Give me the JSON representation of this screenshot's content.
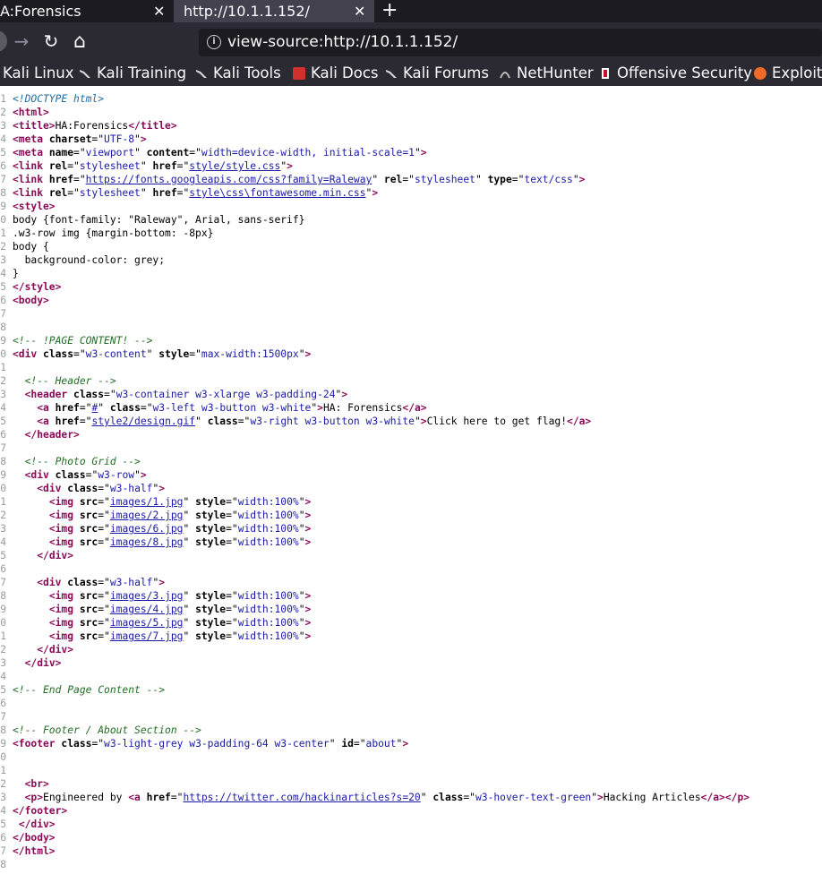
{
  "browser": {
    "tabs": [
      {
        "label": "A:Forensics",
        "close": "✕"
      },
      {
        "label": "http://10.1.1.152/",
        "close": "✕"
      }
    ],
    "new_tab": "+",
    "nav": {
      "back": "←",
      "forward": "→",
      "reload": "↻",
      "home": "⌂"
    },
    "url": "view-source:http://10.1.1.152/",
    "bookmarks": [
      {
        "label": "Kali Linux",
        "icon": "kali-dragon-icon"
      },
      {
        "label": "Kali Training",
        "icon": "kali-dragon-icon"
      },
      {
        "label": "Kali Tools",
        "icon": "kali-dragon-icon"
      },
      {
        "label": "Kali Docs",
        "icon": "kali-docs-icon"
      },
      {
        "label": "Kali Forums",
        "icon": "kali-dragon-icon"
      },
      {
        "label": "NetHunter",
        "icon": "nethunter-icon"
      },
      {
        "label": "Offensive Security",
        "icon": "offsec-icon"
      },
      {
        "label": "Exploit-",
        "icon": "exploit-db-icon"
      }
    ]
  },
  "source_lines": [
    [
      [
        "dt",
        "<!DOCTYPE html>"
      ]
    ],
    [
      [
        "tg",
        "<html>"
      ]
    ],
    [
      [
        "tg",
        "<title>"
      ],
      [
        "tx",
        "HA:Forensics"
      ],
      [
        "tg",
        "</title>"
      ]
    ],
    [
      [
        "tg",
        "<meta "
      ],
      [
        "an",
        "charset"
      ],
      [
        "tx",
        "=\""
      ],
      [
        "av",
        "UTF-8"
      ],
      [
        "tx",
        "\""
      ],
      [
        "tg",
        ">"
      ]
    ],
    [
      [
        "tg",
        "<meta "
      ],
      [
        "an",
        "name"
      ],
      [
        "tx",
        "=\""
      ],
      [
        "av",
        "viewport"
      ],
      [
        "tx",
        "\" "
      ],
      [
        "an",
        "content"
      ],
      [
        "tx",
        "=\""
      ],
      [
        "av",
        "width=device-width, initial-scale=1"
      ],
      [
        "tx",
        "\""
      ],
      [
        "tg",
        ">"
      ]
    ],
    [
      [
        "tg",
        "<link "
      ],
      [
        "an",
        "rel"
      ],
      [
        "tx",
        "=\""
      ],
      [
        "av",
        "stylesheet"
      ],
      [
        "tx",
        "\" "
      ],
      [
        "an",
        "href"
      ],
      [
        "tx",
        "=\""
      ],
      [
        "lk",
        "style/style.css"
      ],
      [
        "tx",
        "\""
      ],
      [
        "tg",
        ">"
      ]
    ],
    [
      [
        "tg",
        "<link "
      ],
      [
        "an",
        "href"
      ],
      [
        "tx",
        "=\""
      ],
      [
        "lk",
        "https://fonts.googleapis.com/css?family=Raleway"
      ],
      [
        "tx",
        "\" "
      ],
      [
        "an",
        "rel"
      ],
      [
        "tx",
        "=\""
      ],
      [
        "av",
        "stylesheet"
      ],
      [
        "tx",
        "\" "
      ],
      [
        "an",
        "type"
      ],
      [
        "tx",
        "=\""
      ],
      [
        "av",
        "text/css"
      ],
      [
        "tx",
        "\""
      ],
      [
        "tg",
        ">"
      ]
    ],
    [
      [
        "tg",
        "<link "
      ],
      [
        "an",
        "rel"
      ],
      [
        "tx",
        "=\""
      ],
      [
        "av",
        "stylesheet"
      ],
      [
        "tx",
        "\" "
      ],
      [
        "an",
        "href"
      ],
      [
        "tx",
        "=\""
      ],
      [
        "lk",
        "style\\css\\fontawesome.min.css"
      ],
      [
        "tx",
        "\""
      ],
      [
        "tg",
        ">"
      ]
    ],
    [
      [
        "tg",
        "<style>"
      ]
    ],
    [
      [
        "tx",
        "body {font-family: \"Raleway\", Arial, sans-serif}"
      ]
    ],
    [
      [
        "tx",
        ".w3-row img {margin-bottom: -8px}"
      ]
    ],
    [
      [
        "tx",
        "body {"
      ]
    ],
    [
      [
        "tx",
        "  background-color: grey;"
      ]
    ],
    [
      [
        "tx",
        "}"
      ]
    ],
    [
      [
        "tg",
        "</style>"
      ]
    ],
    [
      [
        "tg",
        "<body>"
      ]
    ],
    [],
    [],
    [
      [
        "cm",
        "<!-- !PAGE CONTENT! -->"
      ]
    ],
    [
      [
        "tg",
        "<div "
      ],
      [
        "an",
        "class"
      ],
      [
        "tx",
        "=\""
      ],
      [
        "av",
        "w3-content"
      ],
      [
        "tx",
        "\" "
      ],
      [
        "an",
        "style"
      ],
      [
        "tx",
        "=\""
      ],
      [
        "av",
        "max-width:1500px"
      ],
      [
        "tx",
        "\""
      ],
      [
        "tg",
        ">"
      ]
    ],
    [],
    [
      [
        "tx",
        "  "
      ],
      [
        "cm",
        "<!-- Header -->"
      ]
    ],
    [
      [
        "tx",
        "  "
      ],
      [
        "tg",
        "<header "
      ],
      [
        "an",
        "class"
      ],
      [
        "tx",
        "=\""
      ],
      [
        "av",
        "w3-container w3-xlarge w3-padding-24"
      ],
      [
        "tx",
        "\""
      ],
      [
        "tg",
        ">"
      ]
    ],
    [
      [
        "tx",
        "    "
      ],
      [
        "tg",
        "<a "
      ],
      [
        "an",
        "href"
      ],
      [
        "tx",
        "=\""
      ],
      [
        "lk",
        "#"
      ],
      [
        "tx",
        "\" "
      ],
      [
        "an",
        "class"
      ],
      [
        "tx",
        "=\""
      ],
      [
        "av",
        "w3-left w3-button w3-white"
      ],
      [
        "tx",
        "\""
      ],
      [
        "tg",
        ">"
      ],
      [
        "tx",
        "HA: Forensics"
      ],
      [
        "tg",
        "</a>"
      ]
    ],
    [
      [
        "tx",
        "    "
      ],
      [
        "tg",
        "<a "
      ],
      [
        "an",
        "href"
      ],
      [
        "tx",
        "=\""
      ],
      [
        "lk",
        "style2/design.gif"
      ],
      [
        "tx",
        "\" "
      ],
      [
        "an",
        "class"
      ],
      [
        "tx",
        "=\""
      ],
      [
        "av",
        "w3-right w3-button w3-white"
      ],
      [
        "tx",
        "\""
      ],
      [
        "tg",
        ">"
      ],
      [
        "tx",
        "Click here to get flag!"
      ],
      [
        "tg",
        "</a>"
      ]
    ],
    [
      [
        "tx",
        "  "
      ],
      [
        "tg",
        "</header>"
      ]
    ],
    [],
    [
      [
        "tx",
        "  "
      ],
      [
        "cm",
        "<!-- Photo Grid -->"
      ]
    ],
    [
      [
        "tx",
        "  "
      ],
      [
        "tg",
        "<div "
      ],
      [
        "an",
        "class"
      ],
      [
        "tx",
        "=\""
      ],
      [
        "av",
        "w3-row"
      ],
      [
        "tx",
        "\""
      ],
      [
        "tg",
        ">"
      ]
    ],
    [
      [
        "tx",
        "    "
      ],
      [
        "tg",
        "<div "
      ],
      [
        "an",
        "class"
      ],
      [
        "tx",
        "=\""
      ],
      [
        "av",
        "w3-half"
      ],
      [
        "tx",
        "\""
      ],
      [
        "tg",
        ">"
      ]
    ],
    [
      [
        "tx",
        "      "
      ],
      [
        "tg",
        "<img "
      ],
      [
        "an",
        "src"
      ],
      [
        "tx",
        "=\""
      ],
      [
        "lk",
        "images/1.jpg"
      ],
      [
        "tx",
        "\" "
      ],
      [
        "an",
        "style"
      ],
      [
        "tx",
        "=\""
      ],
      [
        "av",
        "width:100%"
      ],
      [
        "tx",
        "\""
      ],
      [
        "tg",
        ">"
      ]
    ],
    [
      [
        "tx",
        "      "
      ],
      [
        "tg",
        "<img "
      ],
      [
        "an",
        "src"
      ],
      [
        "tx",
        "=\""
      ],
      [
        "lk",
        "images/2.jpg"
      ],
      [
        "tx",
        "\" "
      ],
      [
        "an",
        "style"
      ],
      [
        "tx",
        "=\""
      ],
      [
        "av",
        "width:100%"
      ],
      [
        "tx",
        "\""
      ],
      [
        "tg",
        ">"
      ]
    ],
    [
      [
        "tx",
        "      "
      ],
      [
        "tg",
        "<img "
      ],
      [
        "an",
        "src"
      ],
      [
        "tx",
        "=\""
      ],
      [
        "lk",
        "images/6.jpg"
      ],
      [
        "tx",
        "\" "
      ],
      [
        "an",
        "style"
      ],
      [
        "tx",
        "=\""
      ],
      [
        "av",
        "width:100%"
      ],
      [
        "tx",
        "\""
      ],
      [
        "tg",
        ">"
      ]
    ],
    [
      [
        "tx",
        "      "
      ],
      [
        "tg",
        "<img "
      ],
      [
        "an",
        "src"
      ],
      [
        "tx",
        "=\""
      ],
      [
        "lk",
        "images/8.jpg"
      ],
      [
        "tx",
        "\" "
      ],
      [
        "an",
        "style"
      ],
      [
        "tx",
        "=\""
      ],
      [
        "av",
        "width:100%"
      ],
      [
        "tx",
        "\""
      ],
      [
        "tg",
        ">"
      ]
    ],
    [
      [
        "tx",
        "    "
      ],
      [
        "tg",
        "</div>"
      ]
    ],
    [],
    [
      [
        "tx",
        "    "
      ],
      [
        "tg",
        "<div "
      ],
      [
        "an",
        "class"
      ],
      [
        "tx",
        "=\""
      ],
      [
        "av",
        "w3-half"
      ],
      [
        "tx",
        "\""
      ],
      [
        "tg",
        ">"
      ]
    ],
    [
      [
        "tx",
        "      "
      ],
      [
        "tg",
        "<img "
      ],
      [
        "an",
        "src"
      ],
      [
        "tx",
        "=\""
      ],
      [
        "lk",
        "images/3.jpg"
      ],
      [
        "tx",
        "\" "
      ],
      [
        "an",
        "style"
      ],
      [
        "tx",
        "=\""
      ],
      [
        "av",
        "width:100%"
      ],
      [
        "tx",
        "\""
      ],
      [
        "tg",
        ">"
      ]
    ],
    [
      [
        "tx",
        "      "
      ],
      [
        "tg",
        "<img "
      ],
      [
        "an",
        "src"
      ],
      [
        "tx",
        "=\""
      ],
      [
        "lk",
        "images/4.jpg"
      ],
      [
        "tx",
        "\" "
      ],
      [
        "an",
        "style"
      ],
      [
        "tx",
        "=\""
      ],
      [
        "av",
        "width:100%"
      ],
      [
        "tx",
        "\""
      ],
      [
        "tg",
        ">"
      ]
    ],
    [
      [
        "tx",
        "      "
      ],
      [
        "tg",
        "<img "
      ],
      [
        "an",
        "src"
      ],
      [
        "tx",
        "=\""
      ],
      [
        "lk",
        "images/5.jpg"
      ],
      [
        "tx",
        "\" "
      ],
      [
        "an",
        "style"
      ],
      [
        "tx",
        "=\""
      ],
      [
        "av",
        "width:100%"
      ],
      [
        "tx",
        "\""
      ],
      [
        "tg",
        ">"
      ]
    ],
    [
      [
        "tx",
        "      "
      ],
      [
        "tg",
        "<img "
      ],
      [
        "an",
        "src"
      ],
      [
        "tx",
        "=\""
      ],
      [
        "lk",
        "images/7.jpg"
      ],
      [
        "tx",
        "\" "
      ],
      [
        "an",
        "style"
      ],
      [
        "tx",
        "=\""
      ],
      [
        "av",
        "width:100%"
      ],
      [
        "tx",
        "\""
      ],
      [
        "tg",
        ">"
      ]
    ],
    [
      [
        "tx",
        "    "
      ],
      [
        "tg",
        "</div>"
      ]
    ],
    [
      [
        "tx",
        "  "
      ],
      [
        "tg",
        "</div>"
      ]
    ],
    [],
    [
      [
        "cm",
        "<!-- End Page Content -->"
      ]
    ],
    [],
    [],
    [
      [
        "cm",
        "<!-- Footer / About Section -->"
      ]
    ],
    [
      [
        "tg",
        "<footer "
      ],
      [
        "an",
        "class"
      ],
      [
        "tx",
        "=\""
      ],
      [
        "av",
        "w3-light-grey w3-padding-64 w3-center"
      ],
      [
        "tx",
        "\" "
      ],
      [
        "an",
        "id"
      ],
      [
        "tx",
        "=\""
      ],
      [
        "av",
        "about"
      ],
      [
        "tx",
        "\""
      ],
      [
        "tg",
        ">"
      ]
    ],
    [],
    [],
    [
      [
        "tx",
        "  "
      ],
      [
        "tg",
        "<br>"
      ]
    ],
    [
      [
        "tx",
        "  "
      ],
      [
        "tg",
        "<p>"
      ],
      [
        "tx",
        "Engineered by "
      ],
      [
        "tg",
        "<a "
      ],
      [
        "an",
        "href"
      ],
      [
        "tx",
        "=\""
      ],
      [
        "lk",
        "https://twitter.com/hackinarticles?s=20"
      ],
      [
        "tx",
        "\" "
      ],
      [
        "an",
        "class"
      ],
      [
        "tx",
        "=\""
      ],
      [
        "av",
        "w3-hover-text-green"
      ],
      [
        "tx",
        "\""
      ],
      [
        "tg",
        ">"
      ],
      [
        "tx",
        "Hacking Articles"
      ],
      [
        "tg",
        "</a></p>"
      ]
    ],
    [
      [
        "tg",
        "</footer>"
      ]
    ],
    [
      [
        "tx",
        " "
      ],
      [
        "tg",
        "</div>"
      ]
    ],
    [
      [
        "tg",
        "</body>"
      ]
    ],
    [
      [
        "tg",
        "</html>"
      ]
    ],
    []
  ]
}
